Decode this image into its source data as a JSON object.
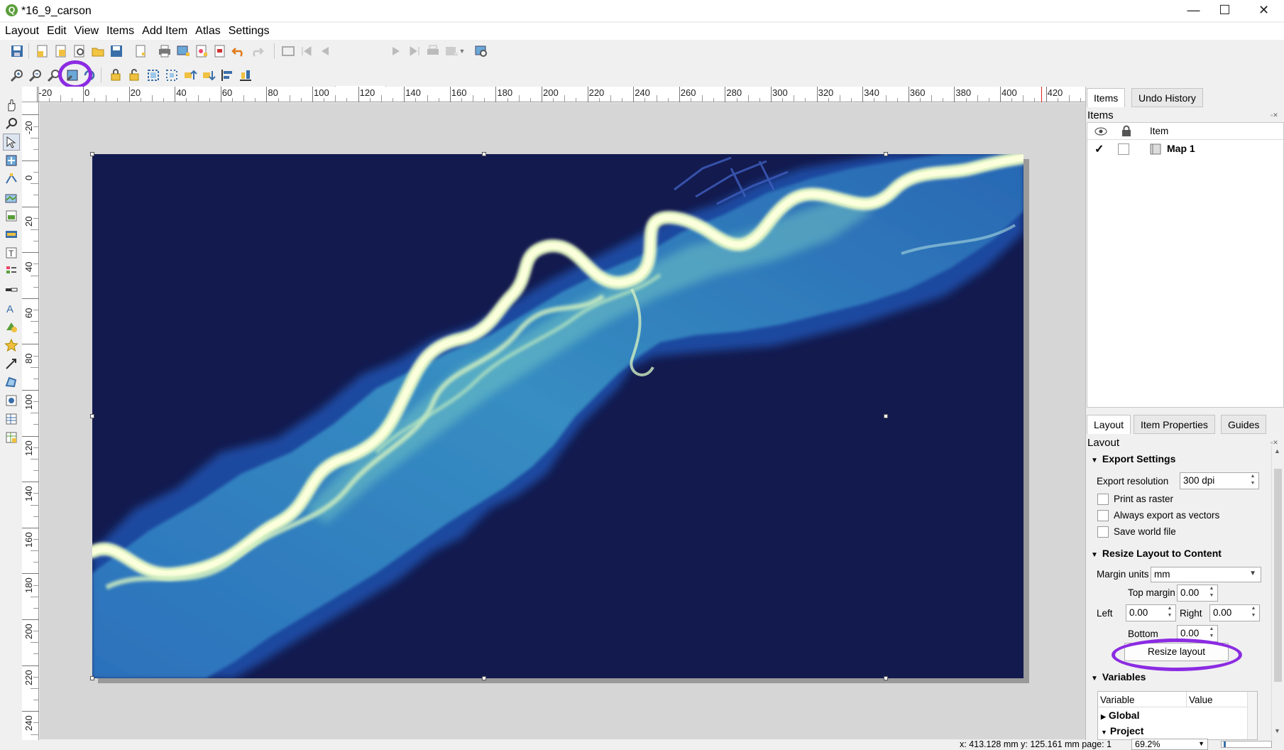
{
  "window": {
    "title": "*16_9_carson",
    "minimize": "—",
    "maximize": "☐",
    "close": "✕",
    "logo": "Q"
  },
  "menu": [
    "Layout",
    "Edit",
    "View",
    "Items",
    "Add Item",
    "Atlas",
    "Settings"
  ],
  "atlas_toolbar": {
    "page_value": "1"
  },
  "ruler": {
    "top_ticks": [
      "-20",
      "0",
      "20",
      "40",
      "60",
      "80",
      "100",
      "120",
      "140",
      "160",
      "180",
      "200",
      "220",
      "240",
      "260",
      "280",
      "300",
      "320",
      "340",
      "360",
      "380",
      "400",
      "420"
    ],
    "left_ticks": [
      "-20",
      "0",
      "20",
      "40",
      "60",
      "80",
      "100",
      "120",
      "140",
      "160",
      "180",
      "200",
      "220",
      "240"
    ]
  },
  "items_panel": {
    "tabs": [
      "Items",
      "Undo History"
    ],
    "title": "Items",
    "column_item": "Item",
    "rows": [
      {
        "visible": true,
        "locked": false,
        "name": "Map 1",
        "checkmark": "✓"
      }
    ]
  },
  "layout_panel": {
    "tabs": [
      "Layout",
      "Item Properties",
      "Guides"
    ],
    "title": "Layout",
    "export_settings": {
      "heading": "Export Settings",
      "resolution_label": "Export resolution",
      "resolution_value": "300 dpi",
      "print_as_raster": "Print as raster",
      "always_vectors": "Always export as vectors",
      "save_world_file": "Save world file"
    },
    "resize": {
      "heading": "Resize Layout to Content",
      "margin_units_label": "Margin units",
      "margin_units_value": "mm",
      "top_label": "Top margin",
      "top_value": "0.00",
      "left_label": "Left",
      "left_value": "0.00",
      "right_label": "Right",
      "right_value": "0.00",
      "bottom_label": "Bottom",
      "bottom_value": "0.00",
      "button": "Resize layout"
    },
    "variables": {
      "heading": "Variables",
      "col_variable": "Variable",
      "col_value": "Value",
      "groups": [
        "Global",
        "Project"
      ]
    }
  },
  "status": {
    "coords": "x: 413.128 mm y: 125.161 mm page: 1",
    "zoom": "69.2%"
  },
  "colors": {
    "map_bg": "#131a4e",
    "highlight": "#8b2be2"
  }
}
